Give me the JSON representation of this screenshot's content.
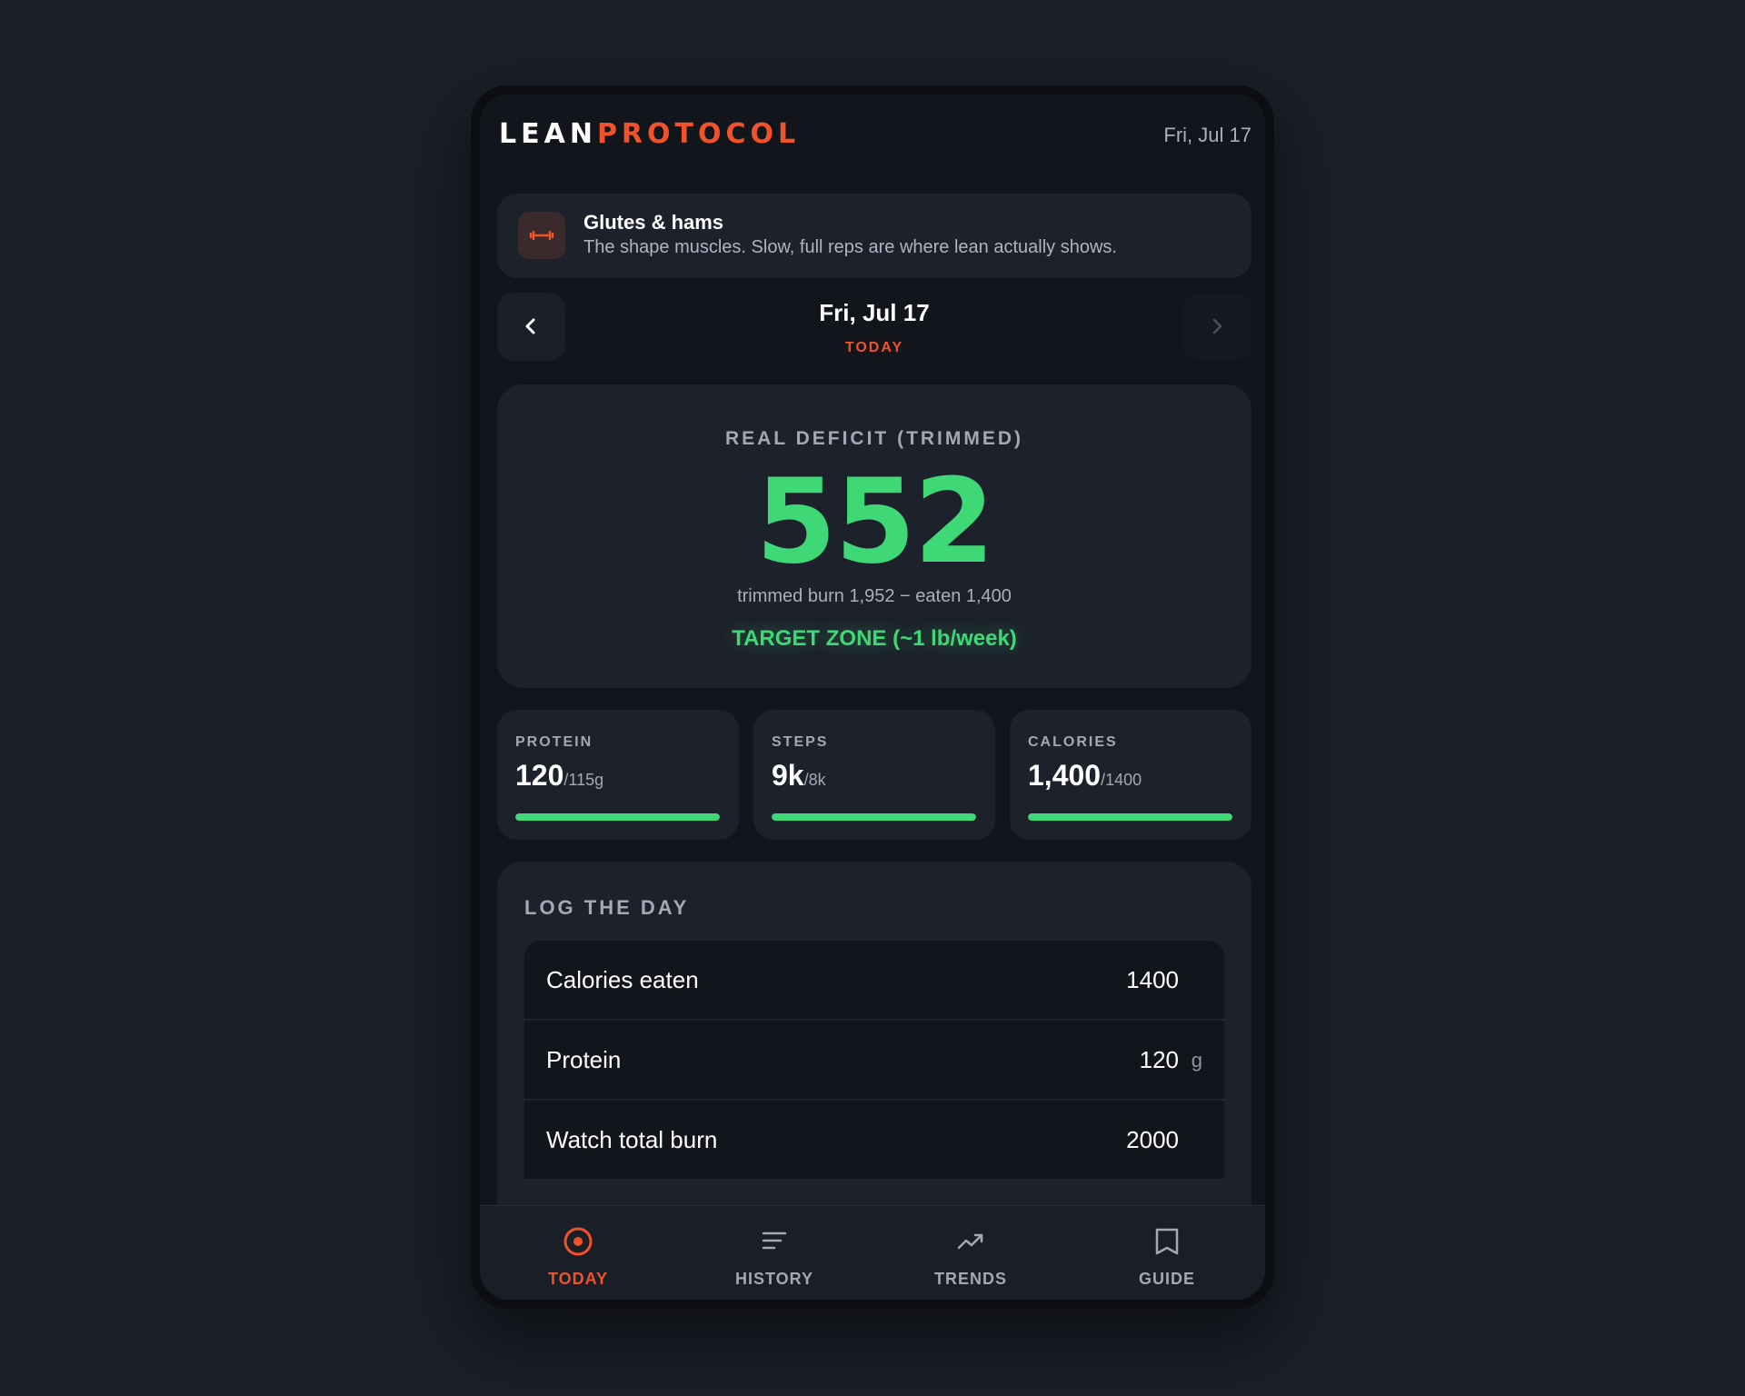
{
  "app": {
    "logo_part1": "LEAN",
    "logo_part2": "PROTOCOL",
    "header_date": "Fri, Jul 17"
  },
  "colors": {
    "accent": "#f0532b",
    "success": "#3ed876",
    "background": "#1b1f28",
    "card": "#1d212b"
  },
  "tip": {
    "icon": "dumbbell-icon",
    "title": "Glutes & hams",
    "body": "The shape muscles. Slow, full reps are where lean actually shows."
  },
  "date_nav": {
    "title": "Fri, Jul 17",
    "subtitle": "TODAY",
    "prev_icon": "chevron-left-icon",
    "next_icon": "chevron-right-icon"
  },
  "deficit": {
    "label": "REAL DEFICIT (TRIMMED)",
    "value": "552",
    "detail": "trimmed burn 1,952 − eaten 1,400",
    "zone": "TARGET ZONE (~1 lb/week)"
  },
  "stats": [
    {
      "label": "PROTEIN",
      "value": "120",
      "goal": "/115g",
      "progress": 1.0
    },
    {
      "label": "STEPS",
      "value": "9k",
      "goal": "/8k",
      "progress": 1.0
    },
    {
      "label": "CALORIES",
      "value": "1,400",
      "goal": "/1400",
      "progress": 1.0
    }
  ],
  "log": {
    "title": "LOG THE DAY",
    "rows": [
      {
        "label": "Calories eaten",
        "value": "1400",
        "unit": ""
      },
      {
        "label": "Protein",
        "value": "120",
        "unit": "g"
      },
      {
        "label": "Watch total burn",
        "value": "2000",
        "unit": ""
      }
    ]
  },
  "bottom_nav": [
    {
      "label": "TODAY",
      "icon": "target-icon",
      "active": true
    },
    {
      "label": "HISTORY",
      "icon": "list-icon",
      "active": false
    },
    {
      "label": "TRENDS",
      "icon": "trend-up-icon",
      "active": false
    },
    {
      "label": "GUIDE",
      "icon": "book-icon",
      "active": false
    }
  ]
}
